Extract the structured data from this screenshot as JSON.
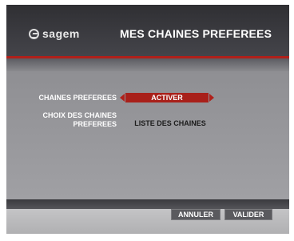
{
  "header": {
    "brand": "sagem",
    "title": "MES CHAINES PREFEREES"
  },
  "settings": {
    "favorites": {
      "label": "CHAINES PREFEREES",
      "value": "ACTIVER"
    },
    "choice": {
      "label_line1": "CHOIX DES CHAINES",
      "label_line2": "PREFEREES",
      "value": "LISTE DES CHAINES"
    }
  },
  "footer": {
    "cancel_label": "ANNULER",
    "validate_label": "VALIDER"
  },
  "colors": {
    "accent": "#a8201a",
    "header_bg": "#35353a",
    "content_bg": "#9a9a9c"
  },
  "icons": {
    "brand": "sagem-logo-icon",
    "prev": "arrow-left-icon",
    "next": "arrow-right-icon"
  }
}
